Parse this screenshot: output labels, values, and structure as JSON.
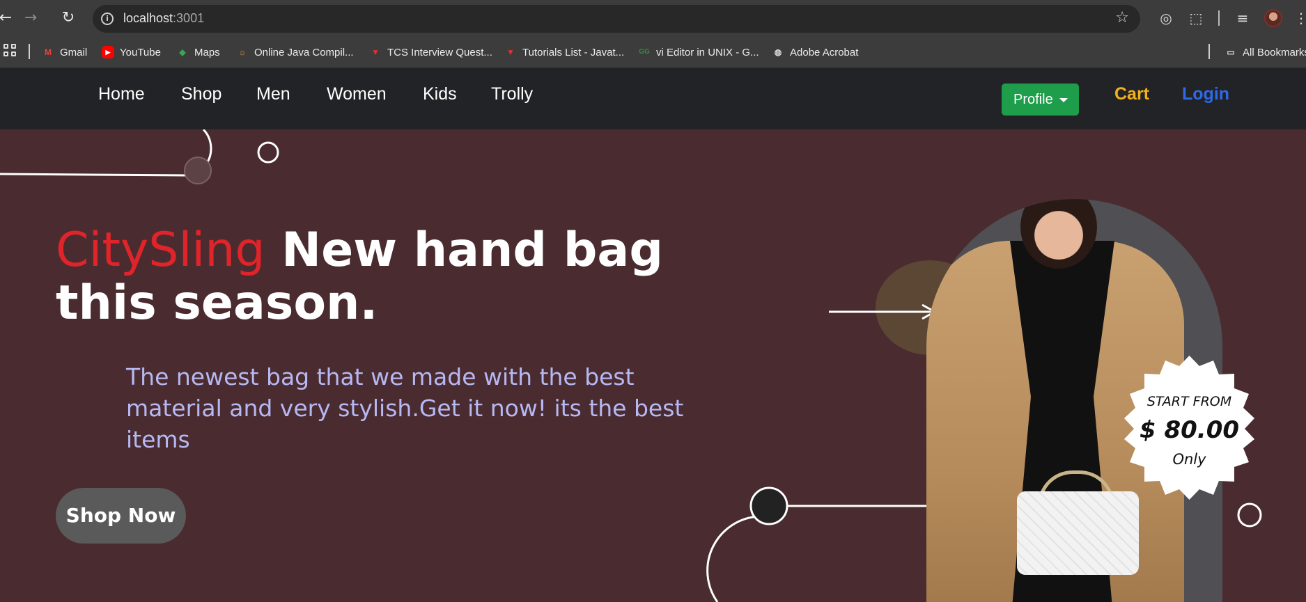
{
  "browser": {
    "url_host": "localhost",
    "url_port": ":3001",
    "back_icon": "arrow-left-icon",
    "forward_icon": "arrow-right-icon",
    "reload_icon": "reload-icon"
  },
  "bookmarks": [
    {
      "label": "Gmail",
      "icon": "gmail-icon",
      "color": "#ea4335"
    },
    {
      "label": "YouTube",
      "icon": "youtube-icon",
      "color": "#ff0000"
    },
    {
      "label": "Maps",
      "icon": "maps-icon",
      "color": "#34a853"
    },
    {
      "label": "Online Java Compil...",
      "icon": "compiler-icon",
      "color": "#f29b30"
    },
    {
      "label": "TCS Interview Quest...",
      "icon": "tcs-icon",
      "color": "#e03030"
    },
    {
      "label": "Tutorials List - Javat...",
      "icon": "tutorials-icon",
      "color": "#e03030"
    },
    {
      "label": "vi Editor in UNIX - G...",
      "icon": "gfg-icon",
      "color": "#2f8d46"
    },
    {
      "label": "Adobe Acrobat",
      "icon": "globe-icon",
      "color": "#dddddd"
    }
  ],
  "all_bookmarks_label": "All Bookmarks",
  "nav": {
    "links": [
      "Home",
      "Shop",
      "Men",
      "Women",
      "Kids",
      "Trolly"
    ],
    "profile_label": "Profile",
    "cart_label": "Cart",
    "login_label": "Login",
    "colors": {
      "cart": "#f0b020",
      "login": "#2f6ae6",
      "profile": "#1e9e4b"
    }
  },
  "hero": {
    "brand": "CitySling",
    "headline_rest": " New hand bag this season.",
    "subtext": "The newest bag that we made with the best material and very stylish.Get it now! its the best items",
    "cta_label": "Shop Now",
    "badge": {
      "top": "START FROM",
      "price": "$ 80.00",
      "bottom": "Only"
    },
    "colors": {
      "background": "#4a2c30",
      "brand": "#e0242a",
      "subtext": "#b7b8f3"
    }
  }
}
